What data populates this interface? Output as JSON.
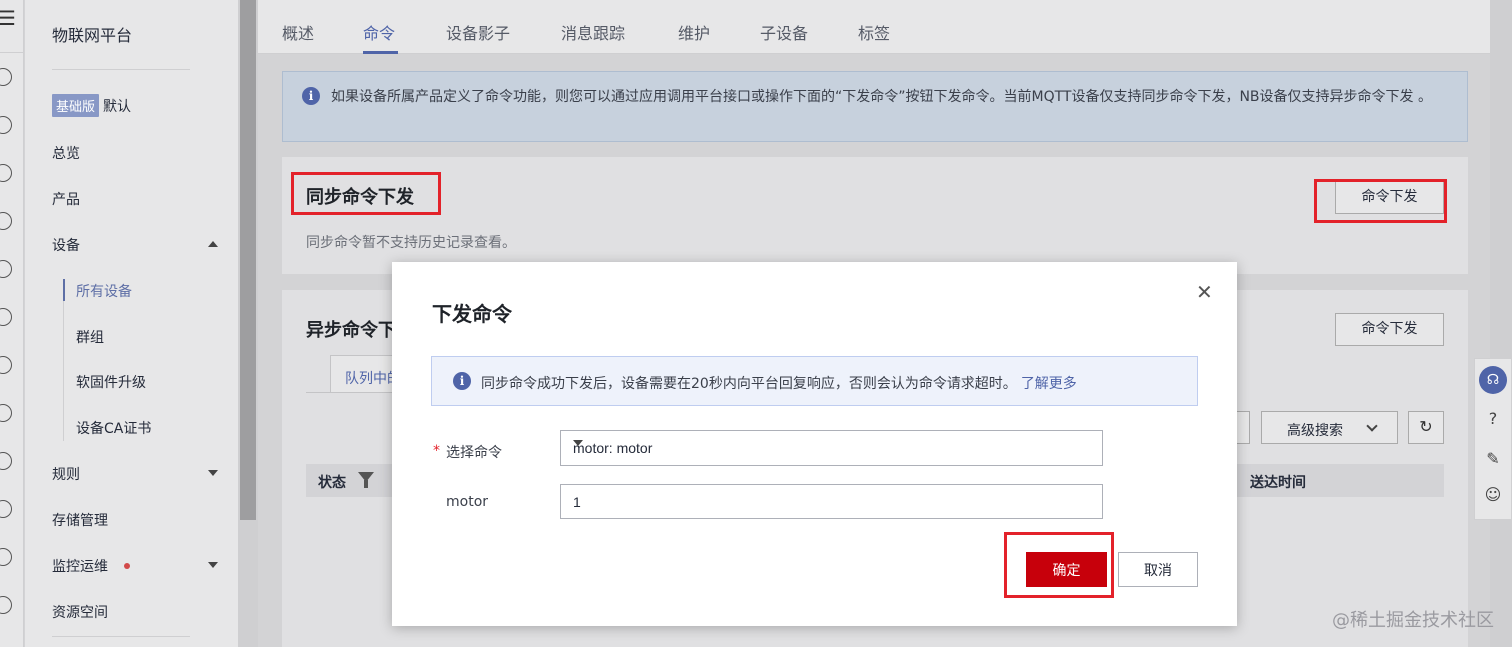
{
  "sidebar": {
    "title": "物联网平台",
    "edition_badge": "基础版",
    "edition_label": "默认",
    "items": {
      "overview": "总览",
      "products": "产品",
      "devices": "设备",
      "rules": "规则",
      "storage": "存储管理",
      "monitoring": "监控运维",
      "resource_space": "资源空间"
    },
    "device_subitems": [
      "所有设备",
      "群组",
      "软固件升级",
      "设备CA证书"
    ]
  },
  "tabs": [
    "概述",
    "命令",
    "设备影子",
    "消息跟踪",
    "维护",
    "子设备",
    "标签"
  ],
  "active_tab": "命令",
  "info_bar": {
    "text": "如果设备所属产品定义了命令功能，则您可以通过应用调用平台接口或操作下面的“下发命令”按钮下发命令。当前MQTT设备仅支持同步命令下发，NB设备仅支持异步命令下发 。"
  },
  "sync_section": {
    "title": "同步命令下发",
    "note": "同步命令暂不支持历史记录查看。",
    "button": "命令下发"
  },
  "async_section": {
    "title": "异步命令下发",
    "button": "命令下发",
    "subtab": "队列中的命令",
    "advanced_search": "高级搜索",
    "columns": {
      "status": "状态",
      "delivered_time": "送达时间"
    }
  },
  "modal": {
    "title": "下发命令",
    "info_text": "同步命令成功下发后，设备需要在20秒内向平台回复响应，否则会认为命令请求超时。",
    "info_link": "了解更多",
    "select_label": "选择命令",
    "select_value": "motor: motor",
    "param_label": "motor",
    "param_value": "1",
    "confirm": "确定",
    "cancel": "取消"
  },
  "watermark": "@稀土掘金技术社区",
  "colors": {
    "accent": "#4f64a8",
    "confirm_red": "#c7000b",
    "highlight_red": "#e3222a"
  }
}
